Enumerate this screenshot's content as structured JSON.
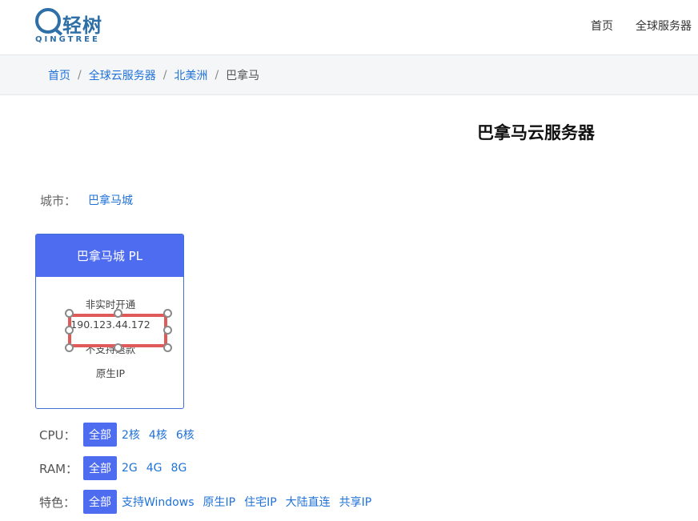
{
  "logo": {
    "cn": "轻树",
    "en": "QINGTREE"
  },
  "nav": [
    {
      "label": "首页"
    },
    {
      "label": "全球服务器"
    }
  ],
  "breadcrumb": {
    "items": [
      "首页",
      "全球云服务器",
      "北美洲"
    ],
    "current": "巴拿马"
  },
  "page_title": "巴拿马云服务器",
  "city": {
    "label": "城市：",
    "value": "巴拿马城"
  },
  "card": {
    "title": "巴拿马城 PL",
    "features": [
      "非实时开通",
      "190.123.44.172",
      "不支持退款",
      "原生IP"
    ]
  },
  "filters": {
    "cpu": {
      "label": "CPU：",
      "all": "全部",
      "options": [
        "2核",
        "4核",
        "6核"
      ]
    },
    "ram": {
      "label": "RAM：",
      "all": "全部",
      "options": [
        "2G",
        "4G",
        "8G"
      ]
    },
    "feature": {
      "label": "特色：",
      "all": "全部",
      "options": [
        "支持Windows",
        "原生IP",
        "住宅IP",
        "大陆直连",
        "共享IP"
      ]
    }
  },
  "colors": {
    "accent": "#4e6cf0",
    "link": "#1f72d8",
    "selection": "#e05a5a"
  }
}
